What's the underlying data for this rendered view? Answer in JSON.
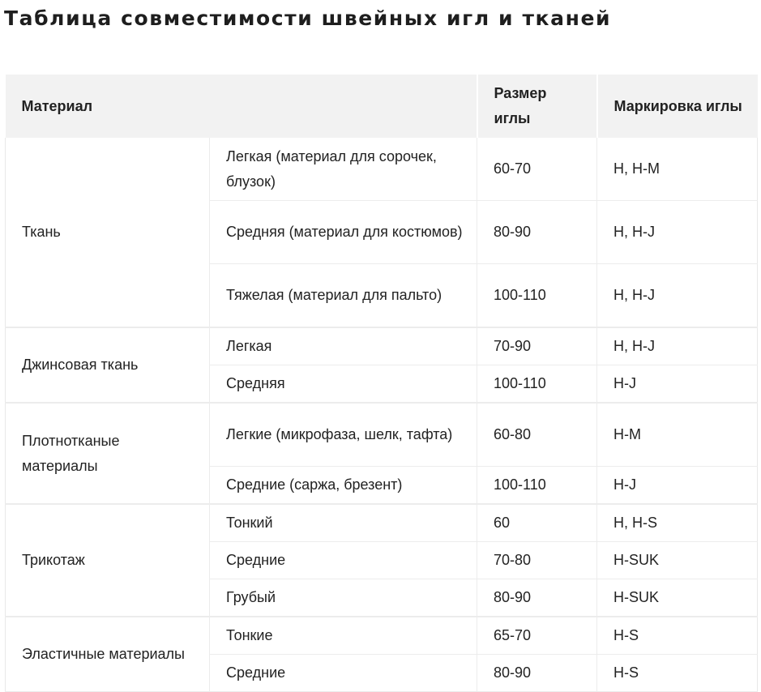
{
  "title": "Таблица совместимости швейных игл и тканей",
  "table": {
    "headers": {
      "material": "Материал",
      "size": "Размер иглы",
      "marking": "Маркировка иглы"
    },
    "groups": [
      {
        "material": "Ткань",
        "rows": [
          {
            "subtype": "Легкая (материал для сорочек, блузок)",
            "size": "60-70",
            "marking": "H, H-M"
          },
          {
            "subtype": "Средняя (материал для костюмов)",
            "size": "80-90",
            "marking": "H, H-J"
          },
          {
            "subtype": "Тяжелая (материал для пальто)",
            "size": "100-110",
            "marking": "H, H-J"
          }
        ]
      },
      {
        "material": "Джинсовая ткань",
        "rows": [
          {
            "subtype": "Легкая",
            "size": "70-90",
            "marking": "H, H-J"
          },
          {
            "subtype": "Средняя",
            "size": "100-110",
            "marking": "H-J"
          }
        ]
      },
      {
        "material": "Плотнотканые материалы",
        "rows": [
          {
            "subtype": "Легкие (микрофаза, шелк, тафта)",
            "size": "60-80",
            "marking": "H-M"
          },
          {
            "subtype": "Средние (саржа, брезент)",
            "size": "100-110",
            "marking": "H-J"
          }
        ]
      },
      {
        "material": "Трикотаж",
        "rows": [
          {
            "subtype": "Тонкий",
            "size": "60",
            "marking": "H, H-S"
          },
          {
            "subtype": "Средние",
            "size": "70-80",
            "marking": "H-SUK"
          },
          {
            "subtype": "Грубый",
            "size": "80-90",
            "marking": "H-SUK"
          }
        ]
      },
      {
        "material": "Эластичные материалы",
        "rows": [
          {
            "subtype": "Тонкие",
            "size": "65-70",
            "marking": "H-S"
          },
          {
            "subtype": "Средние",
            "size": "80-90",
            "marking": "H-S"
          }
        ]
      }
    ]
  }
}
